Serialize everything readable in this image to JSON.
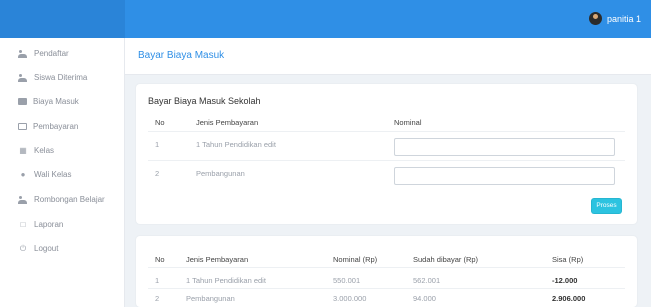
{
  "header": {
    "user_name": "panitia 1"
  },
  "sidebar": {
    "items": [
      {
        "label": "Pendaftar",
        "icon": "users-icon"
      },
      {
        "label": "Siswa Diterima",
        "icon": "user-check-icon"
      },
      {
        "label": "Biaya Masuk",
        "icon": "money-icon"
      },
      {
        "label": "Pembayaran",
        "icon": "payment-icon"
      },
      {
        "label": "Kelas",
        "icon": "building-icon"
      },
      {
        "label": "Wali Kelas",
        "icon": "user-icon"
      },
      {
        "label": "Rombongan Belajar",
        "icon": "group-icon"
      },
      {
        "label": "Laporan",
        "icon": "document-icon"
      },
      {
        "label": "Logout",
        "icon": "power-icon"
      }
    ]
  },
  "page": {
    "title": "Bayar Biaya Masuk"
  },
  "form_card": {
    "title": "Bayar Biaya Masuk Sekolah",
    "columns": [
      "No",
      "Jenis Pembayaran",
      "Nominal"
    ],
    "rows": [
      {
        "no": "1",
        "jenis": "1 Tahun Pendidikan edit",
        "nominal": ""
      },
      {
        "no": "2",
        "jenis": "Pembangunan",
        "nominal": ""
      }
    ],
    "submit_label": "Proses"
  },
  "summary_card": {
    "columns": [
      "No",
      "Jenis Pembayaran",
      "Nominal (Rp)",
      "Sudah dibayar (Rp)",
      "Sisa (Rp)"
    ],
    "rows": [
      {
        "no": "1",
        "jenis": "1 Tahun Pendidikan edit",
        "nominal": "550.001",
        "dibayar": "562.001",
        "sisa": "-12.000"
      },
      {
        "no": "2",
        "jenis": "Pembangunan",
        "nominal": "3.000.000",
        "dibayar": "94.000",
        "sisa": "2.906.000"
      }
    ]
  },
  "colors": {
    "primary": "#2f8fe6",
    "button": "#2cc3e0",
    "background": "#eef2f6"
  }
}
